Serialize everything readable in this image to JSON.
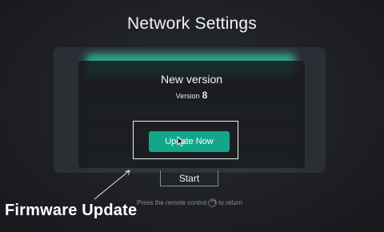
{
  "page": {
    "title": "Network Settings"
  },
  "dialog": {
    "title": "New version",
    "version_label": "Version",
    "version_number": "8",
    "update_button": "Update Now"
  },
  "start_button": "Start",
  "hint": {
    "before": "Press the remote control",
    "after": "to return"
  },
  "annotation": {
    "label": "Firmware Update"
  },
  "colors": {
    "accent": "#12a78a",
    "background": "#1e2026"
  },
  "icons": {
    "cursor": "pointer-cursor-icon",
    "return": "return-icon"
  }
}
